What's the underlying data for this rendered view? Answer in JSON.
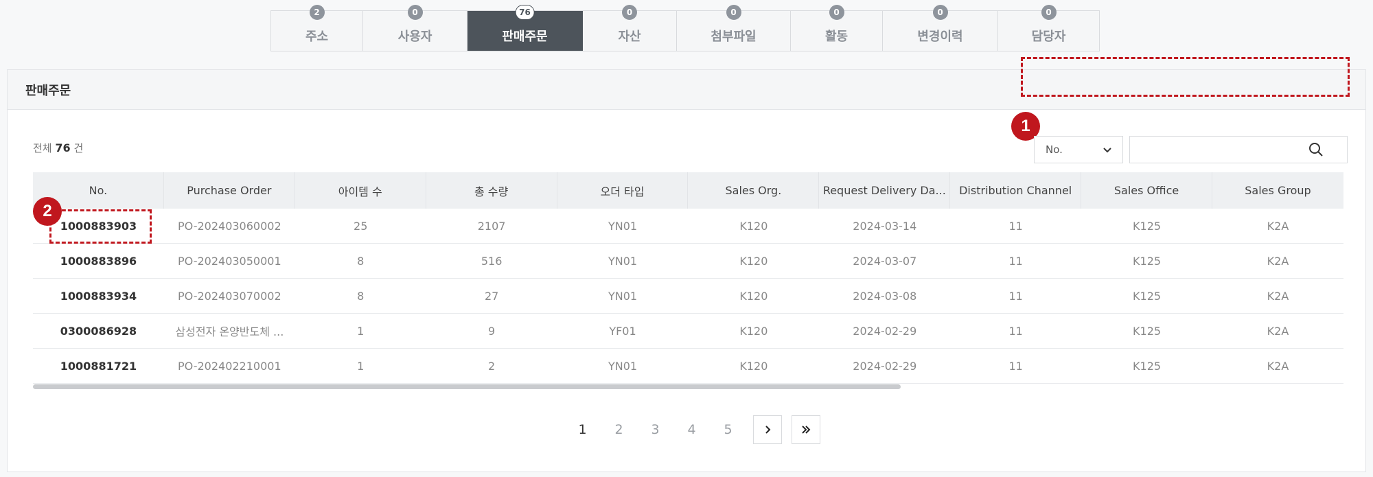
{
  "tabs": [
    {
      "label": "주소",
      "count": "2"
    },
    {
      "label": "사용자",
      "count": "0"
    },
    {
      "label": "판매주문",
      "count": "76",
      "active": true
    },
    {
      "label": "자산",
      "count": "0"
    },
    {
      "label": "첨부파일",
      "count": "0"
    },
    {
      "label": "활동",
      "count": "0"
    },
    {
      "label": "변경이력",
      "count": "0"
    },
    {
      "label": "담당자",
      "count": "0"
    }
  ],
  "panel": {
    "title": "판매주문"
  },
  "total": {
    "prefix": "전체",
    "count": "76",
    "suffix": "건"
  },
  "search": {
    "field_selected": "No.",
    "value": "",
    "placeholder": ""
  },
  "annotations": {
    "badge1": "1",
    "badge2": "2"
  },
  "table": {
    "columns": [
      "No.",
      "Purchase Order",
      "아이템 수",
      "총 수량",
      "오더 타입",
      "Sales Org.",
      "Request Delivery Da...",
      "Distribution Channel",
      "Sales Office",
      "Sales Group"
    ],
    "rows": [
      [
        "1000883903",
        "PO-202403060002",
        "25",
        "2107",
        "YN01",
        "K120",
        "2024-03-14",
        "11",
        "K125",
        "K2A"
      ],
      [
        "1000883896",
        "PO-202403050001",
        "8",
        "516",
        "YN01",
        "K120",
        "2024-03-07",
        "11",
        "K125",
        "K2A"
      ],
      [
        "1000883934",
        "PO-202403070002",
        "8",
        "27",
        "YN01",
        "K120",
        "2024-03-08",
        "11",
        "K125",
        "K2A"
      ],
      [
        "0300086928",
        "삼성전자 온양반도체 ...",
        "1",
        "9",
        "YF01",
        "K120",
        "2024-02-29",
        "11",
        "K125",
        "K2A"
      ],
      [
        "1000881721",
        "PO-202402210001",
        "1",
        "2",
        "YN01",
        "K120",
        "2024-02-29",
        "11",
        "K125",
        "K2A"
      ]
    ]
  },
  "pagination": {
    "pages": [
      "1",
      "2",
      "3",
      "4",
      "5"
    ],
    "current": "1"
  },
  "colors": {
    "accent_dark": "#4d545b",
    "annotation_red": "#c0171e"
  }
}
